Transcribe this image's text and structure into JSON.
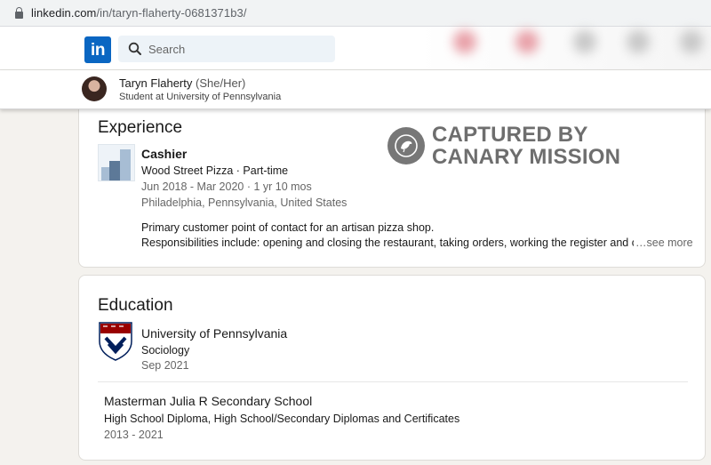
{
  "browser": {
    "url_host": "linkedin.com",
    "url_path": "/in/taryn-flaherty-0681371b3/"
  },
  "nav": {
    "logo_text": "in",
    "search_placeholder": "Search"
  },
  "sticky": {
    "name": "Taryn Flaherty",
    "pronouns": "(She/Her)",
    "headline": "Student at University of Pennsylvania"
  },
  "watermark": {
    "line1": "CAPTURED BY",
    "line2": "CANARY MISSION"
  },
  "experience": {
    "title": "Experience",
    "items": [
      {
        "role": "Cashier",
        "company": "Wood Street Pizza · Part-time",
        "dates": "Jun 2018 - Mar 2020 · 1 yr 10 mos",
        "location": "Philadelphia, Pennsylvania, United States",
        "desc1": "Primary customer point of contact for an artisan pizza shop.",
        "desc2": "Responsibilities include: opening and closing the restaurant, taking orders, working the register and cı",
        "see_more": "…see more"
      }
    ]
  },
  "education": {
    "title": "Education",
    "items": [
      {
        "school": "University of Pennsylvania",
        "degree": "Sociology",
        "dates": "Sep 2021"
      },
      {
        "school": "Masterman Julia R Secondary School",
        "degree": "High School Diploma, High School/Secondary Diplomas and Certificates",
        "dates": "2013 - 2021"
      }
    ]
  },
  "colors": {
    "linkedin_blue": "#0a66c2",
    "penn_red": "#990000",
    "penn_blue": "#011f5b"
  }
}
